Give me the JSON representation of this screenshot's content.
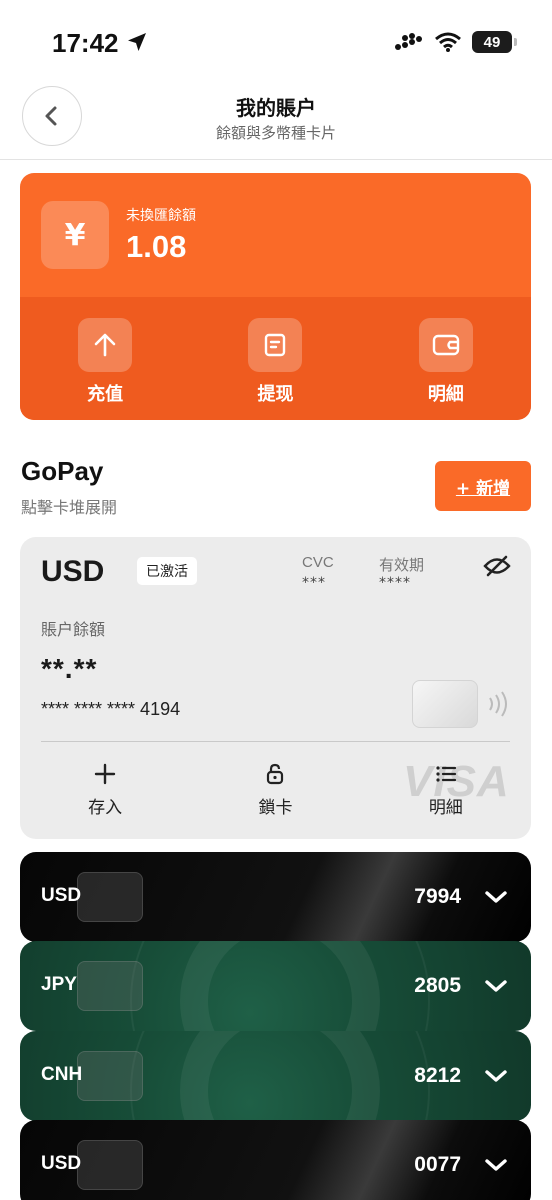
{
  "status_bar": {
    "time": "17:42",
    "battery": "49"
  },
  "nav": {
    "title": "我的賬户",
    "subtitle": "餘額與多幣種卡片"
  },
  "balance": {
    "currency_symbol": "¥",
    "label": "未換匯餘額",
    "value": "1.08",
    "actions": [
      {
        "label": "充值",
        "icon": "arrow-up-icon"
      },
      {
        "label": "提现",
        "icon": "document-icon"
      },
      {
        "label": "明細",
        "icon": "wallet-icon"
      }
    ],
    "color": "#fa6a28"
  },
  "gopay": {
    "title": "GoPay",
    "subtitle": "點擊卡堆展開",
    "add_label": "+ 新增"
  },
  "primary_card": {
    "currency": "USD",
    "status": "已激活",
    "cvc_label": "CVC",
    "cvc_value": "***",
    "expiry_label": "有效期",
    "expiry_value": "****",
    "balance_label": "賬户餘額",
    "balance_value": "**.**",
    "card_number": "**** **** **** 4194",
    "brand": "VISA",
    "actions": [
      {
        "label": "存入",
        "icon": "plus-icon"
      },
      {
        "label": "鎖卡",
        "icon": "lock-icon"
      },
      {
        "label": "明細",
        "icon": "list-icon"
      }
    ]
  },
  "stacked_cards": [
    {
      "currency": "USD",
      "last4": "7994",
      "style": "black"
    },
    {
      "currency": "JPY",
      "last4": "2805",
      "style": "green"
    },
    {
      "currency": "CNH",
      "last4": "8212",
      "style": "green"
    },
    {
      "currency": "USD",
      "last4": "0077",
      "style": "black"
    }
  ]
}
